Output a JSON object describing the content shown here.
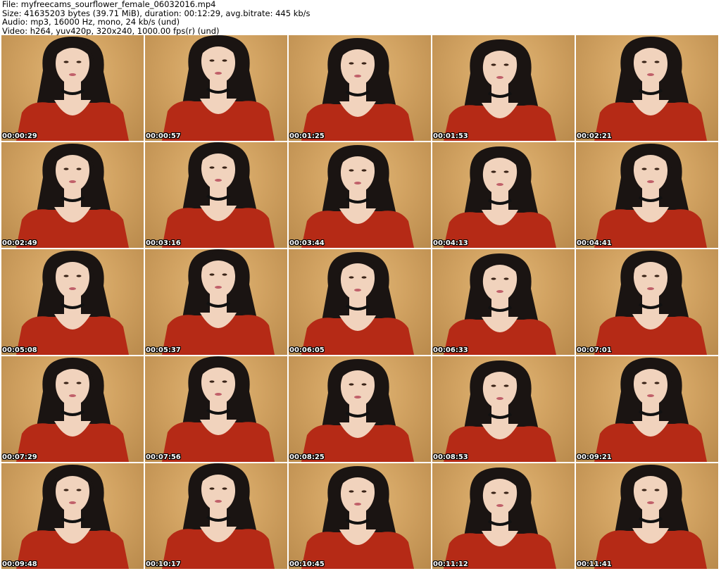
{
  "header": {
    "file_line": "File: myfreecams_sourflower_female_06032016.mp4",
    "size_line": "Size: 41635203 bytes (39.71 MiB), duration: 00:12:29, avg.bitrate: 445 kb/s",
    "audio_line": "Audio: mp3, 16000 Hz, mono, 24 kb/s (und)",
    "video_line": "Video: h264, yuv420p, 320x240, 1000.00 fps(r) (und)"
  },
  "thumbnails": [
    {
      "timestamp": "00:00:29"
    },
    {
      "timestamp": "00:00:57"
    },
    {
      "timestamp": "00:01:25"
    },
    {
      "timestamp": "00:01:53"
    },
    {
      "timestamp": "00:02:21"
    },
    {
      "timestamp": "00:02:49"
    },
    {
      "timestamp": "00:03:16"
    },
    {
      "timestamp": "00:03:44"
    },
    {
      "timestamp": "00:04:13"
    },
    {
      "timestamp": "00:04:41"
    },
    {
      "timestamp": "00:05:08"
    },
    {
      "timestamp": "00:05:37"
    },
    {
      "timestamp": "00:06:05"
    },
    {
      "timestamp": "00:06:33"
    },
    {
      "timestamp": "00:07:01"
    },
    {
      "timestamp": "00:07:29"
    },
    {
      "timestamp": "00:07:56"
    },
    {
      "timestamp": "00:08:25"
    },
    {
      "timestamp": "00:08:53"
    },
    {
      "timestamp": "00:09:21"
    },
    {
      "timestamp": "00:09:48"
    },
    {
      "timestamp": "00:10:17"
    },
    {
      "timestamp": "00:10:45"
    },
    {
      "timestamp": "00:11:12"
    },
    {
      "timestamp": "00:11:41"
    }
  ],
  "colors": {
    "background_wall": "#d2a362",
    "shirt_red": "#b52a16",
    "hair": "#1a1412",
    "skin": "#f1d3bd",
    "choker": "#111111"
  }
}
